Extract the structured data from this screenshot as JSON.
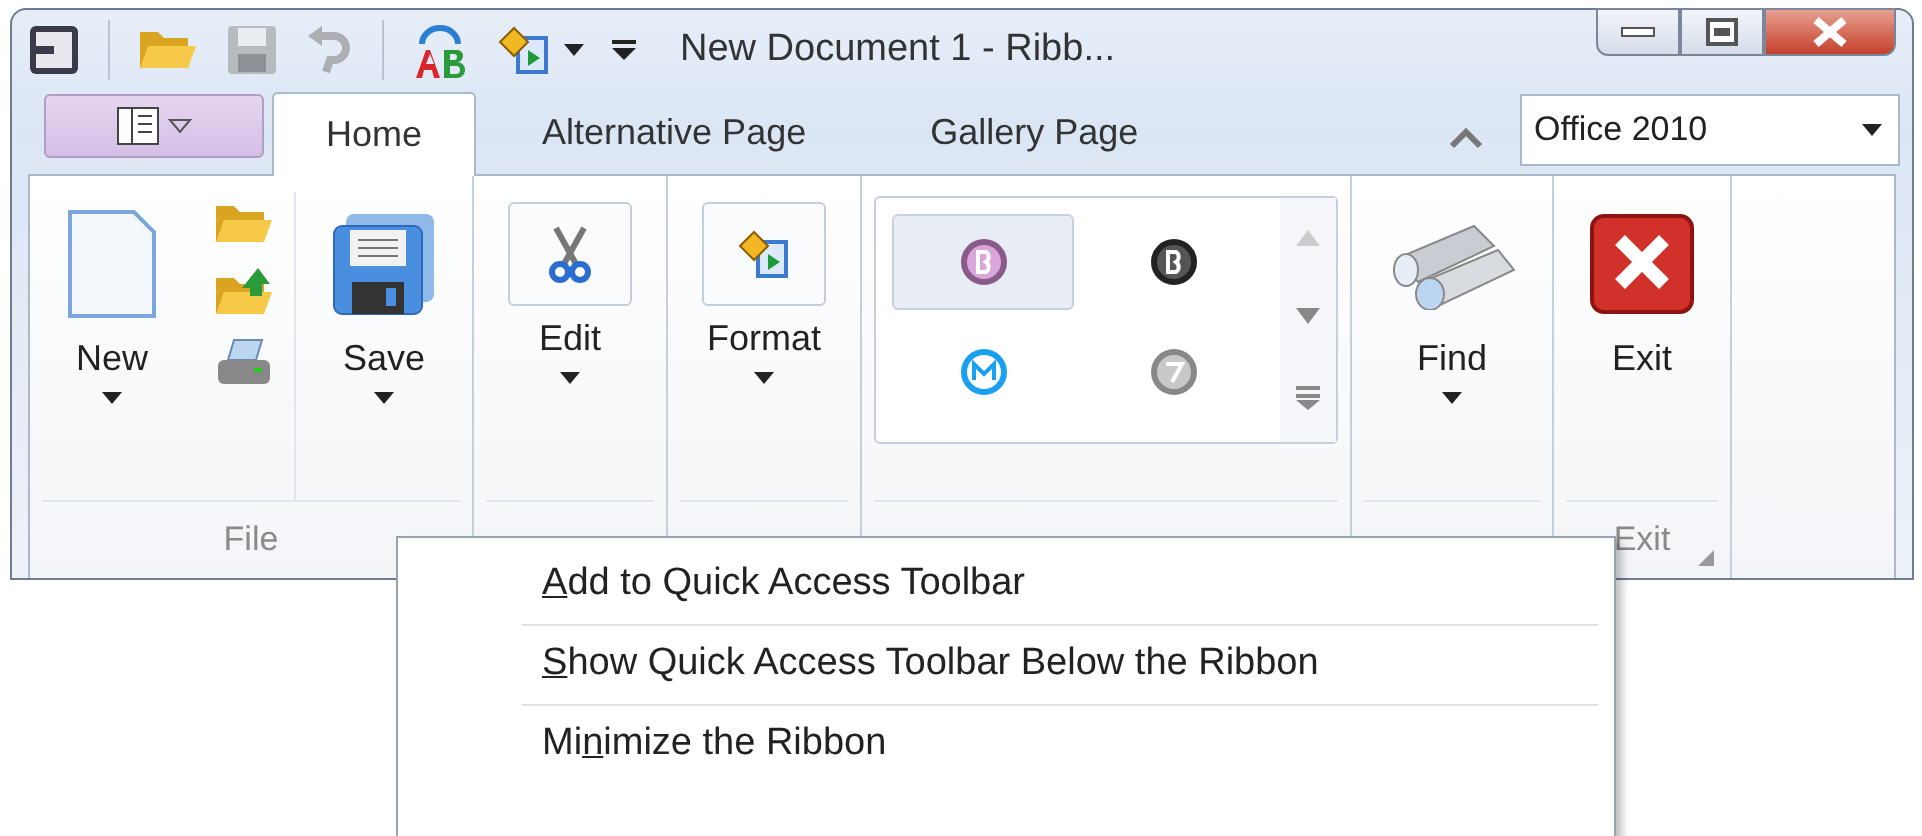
{
  "window": {
    "title": "New Document 1 - Ribb..."
  },
  "quick_access": [
    {
      "kind": "system",
      "disabled": false
    },
    {
      "kind": "open",
      "disabled": false
    },
    {
      "kind": "save",
      "disabled": true
    },
    {
      "kind": "undo",
      "disabled": true
    },
    {
      "kind": "spelling",
      "disabled": false
    },
    {
      "kind": "format",
      "disabled": false
    },
    {
      "kind": "customize",
      "disabled": false
    }
  ],
  "tabs": [
    {
      "label": "Home",
      "selected": true
    },
    {
      "label": "Alternative Page",
      "selected": false
    },
    {
      "label": "Gallery Page",
      "selected": false
    }
  ],
  "skin_combo": {
    "value": "Office 2010"
  },
  "groups": [
    {
      "kind": "file",
      "caption": "File",
      "buttons": [
        {
          "kind": "new",
          "label": "New",
          "dropdown": true
        },
        {
          "kind": "smalls"
        },
        {
          "kind": "save",
          "label": "Save",
          "dropdown": true
        }
      ]
    },
    {
      "kind": "plain",
      "buttons": [
        {
          "kind": "edit",
          "label": "Edit",
          "dropdown": true
        }
      ]
    },
    {
      "kind": "plain",
      "buttons": [
        {
          "kind": "format",
          "label": "Format",
          "dropdown": true
        }
      ]
    },
    {
      "kind": "gallery",
      "items": [
        {
          "selected": true
        },
        {
          "selected": false
        },
        {
          "selected": false
        },
        {
          "selected": false
        }
      ]
    },
    {
      "kind": "plain",
      "buttons": [
        {
          "kind": "find",
          "label": "Find",
          "dropdown": true
        }
      ]
    },
    {
      "kind": "plain",
      "caption": "Exit",
      "launcher": true,
      "buttons": [
        {
          "kind": "exit",
          "label": "Exit",
          "dropdown": false
        }
      ]
    }
  ],
  "context_menu": {
    "items": [
      {
        "key": "A",
        "after": "dd to Quick Access Toolbar"
      },
      {
        "key": "S",
        "after": "how Quick Access Toolbar Below the Ribbon"
      },
      {
        "before": "Mi",
        "key": "n",
        "after": "imize the Ribbon"
      }
    ]
  }
}
